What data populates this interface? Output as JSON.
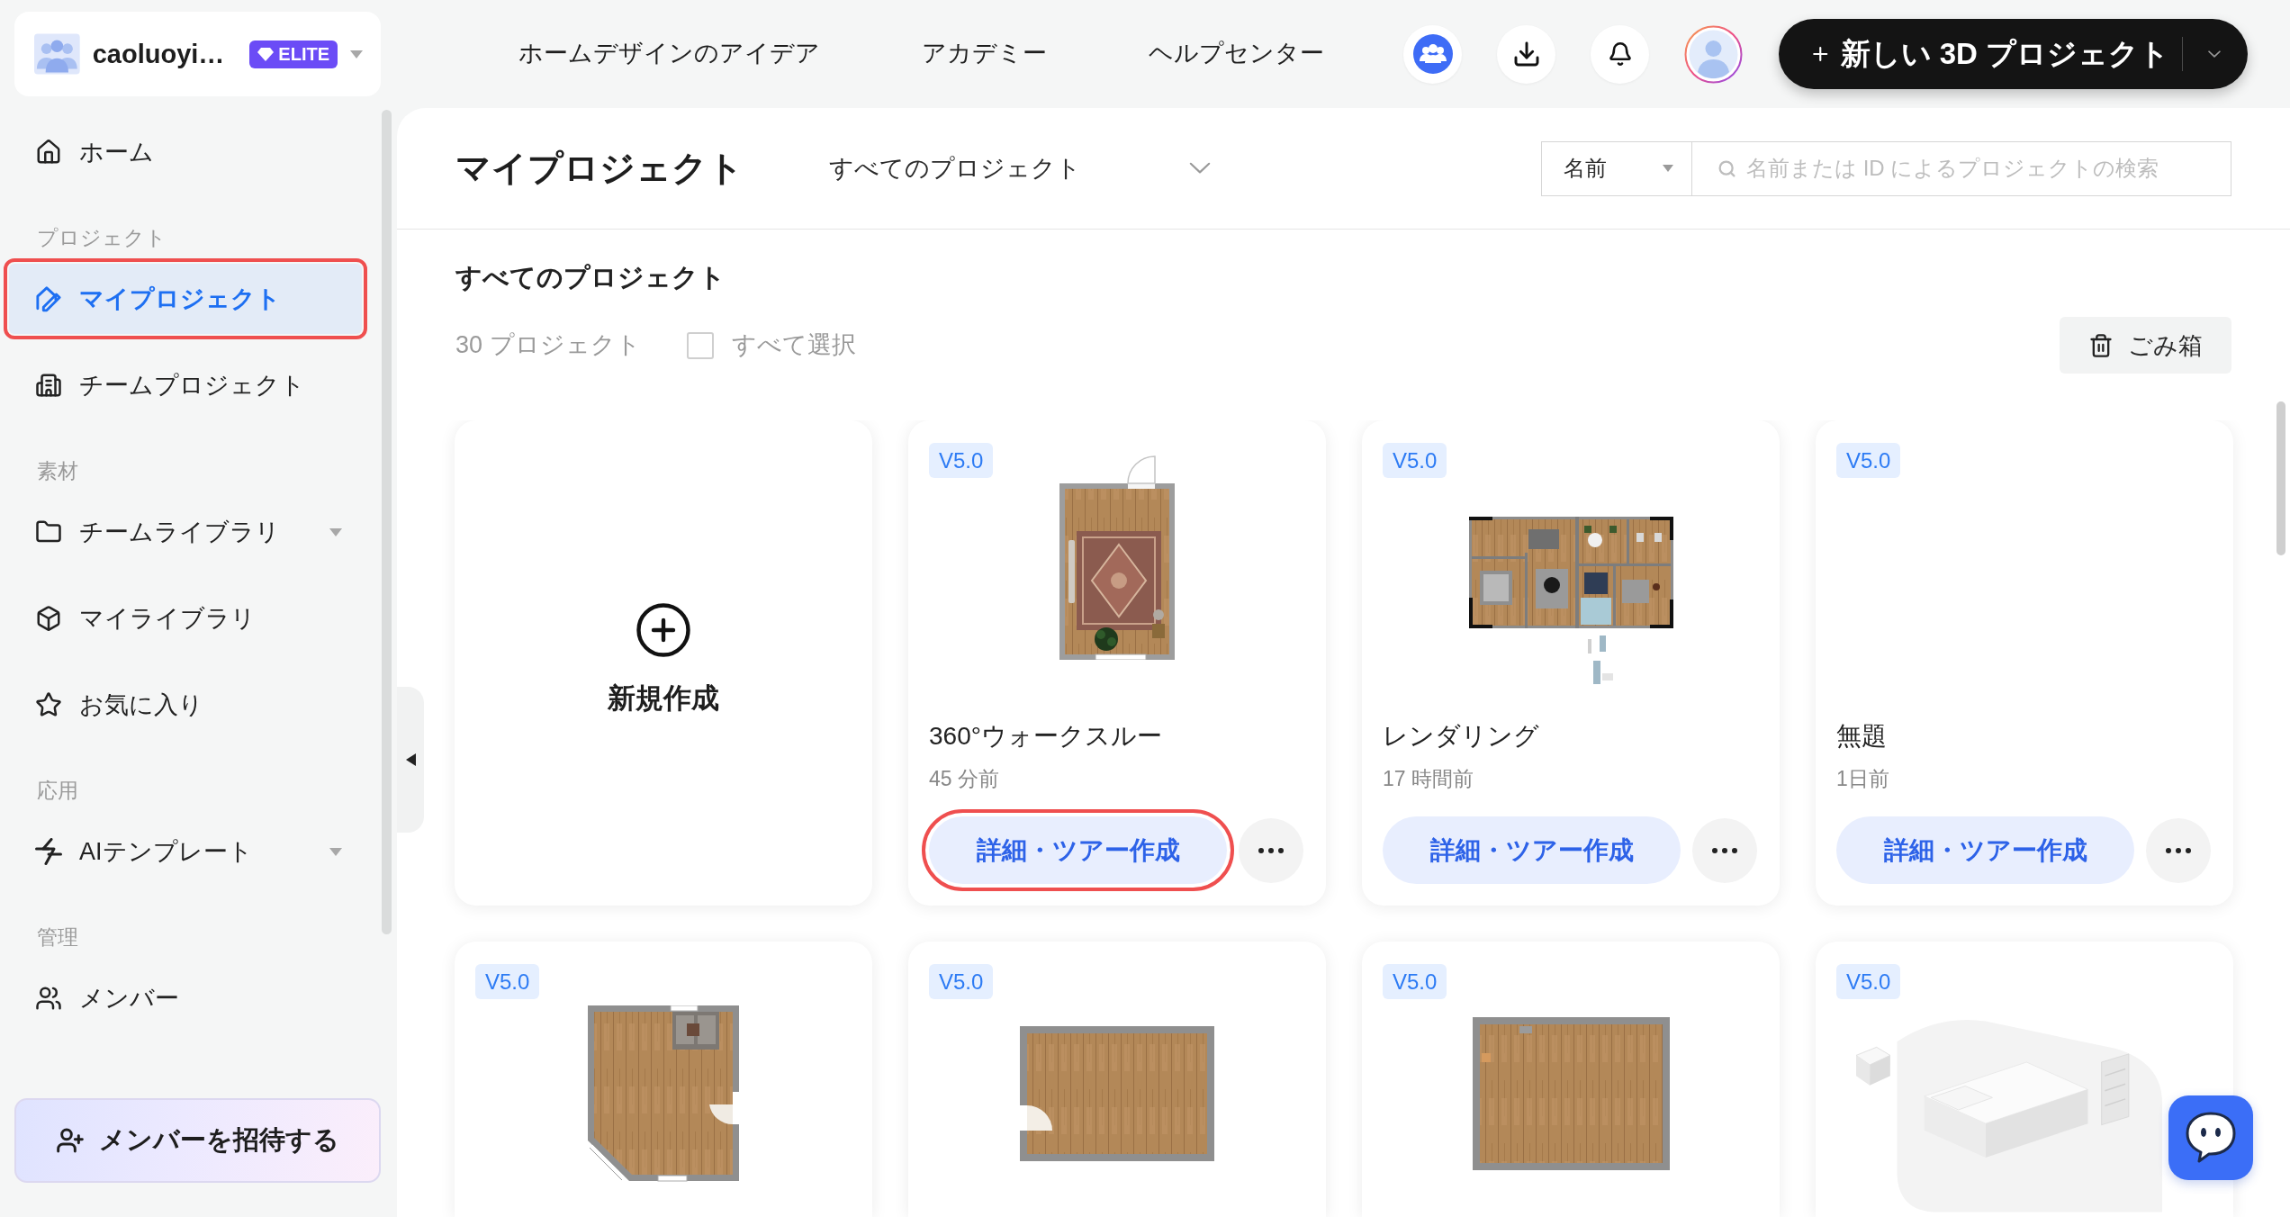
{
  "account": {
    "name": "caoluoyi…",
    "plan": "ELITE"
  },
  "sidebar": {
    "items": [
      {
        "kind": "item",
        "label": "ホーム",
        "selected": false,
        "highlighted": false,
        "expandable": false
      },
      {
        "kind": "section",
        "label": "プロジェクト"
      },
      {
        "kind": "item",
        "label": "マイプロジェクト",
        "selected": true,
        "highlighted": true,
        "expandable": false
      },
      {
        "kind": "item",
        "label": "チームプロジェクト",
        "selected": false,
        "highlighted": false,
        "expandable": false
      },
      {
        "kind": "section",
        "label": "素材"
      },
      {
        "kind": "item",
        "label": "チームライブラリ",
        "selected": false,
        "highlighted": false,
        "expandable": true
      },
      {
        "kind": "item",
        "label": "マイライブラリ",
        "selected": false,
        "highlighted": false,
        "expandable": false
      },
      {
        "kind": "item",
        "label": "お気に入り",
        "selected": false,
        "highlighted": false,
        "expandable": false
      },
      {
        "kind": "section",
        "label": "応用"
      },
      {
        "kind": "item",
        "label": "AIテンプレート",
        "selected": false,
        "highlighted": false,
        "expandable": true
      },
      {
        "kind": "section",
        "label": "管理"
      },
      {
        "kind": "item",
        "label": "メンバー",
        "selected": false,
        "highlighted": false,
        "expandable": false
      }
    ],
    "invite_button": "メンバーを招待する"
  },
  "topbar": {
    "nav": [
      "ホームデザインのアイデア",
      "アカデミー",
      "ヘルプセンター"
    ],
    "new_project_button": "新しい 3D プロジェクト"
  },
  "header": {
    "title": "マイプロジェクト",
    "filter": "すべてのプロジェクト",
    "sort": "名前",
    "search": {
      "placeholder": "名前または ID によるプロジェクトの検索"
    }
  },
  "section": {
    "title": "すべてのプロジェクト",
    "count": "30 プロジェクト",
    "select_all": {
      "label": "すべて選択",
      "checked": false
    },
    "trash_button": "ごみ箱"
  },
  "cards": [
    {
      "kind": "new",
      "label": "新規作成"
    },
    {
      "kind": "project",
      "version": "V5.0",
      "thumbnail": {
        "kind": "room"
      },
      "title": "360°ウォークスルー",
      "time": "45 分前",
      "button": "詳細・ツアー作成",
      "highlighted": true
    },
    {
      "kind": "project",
      "version": "V5.0",
      "thumbnail": {
        "kind": "apartment"
      },
      "title": "レンダリング",
      "time": "17 時間前",
      "button": "詳細・ツアー作成",
      "highlighted": false
    },
    {
      "kind": "project",
      "version": "V5.0",
      "title": "無題",
      "time": "1日前",
      "button": "詳細・ツアー作成",
      "highlighted": false
    },
    {
      "kind": "project",
      "version": "V5.0",
      "thumbnail": {
        "kind": "corner_room"
      }
    },
    {
      "kind": "project",
      "version": "V5.0",
      "thumbnail": {
        "kind": "door_room"
      }
    },
    {
      "kind": "project",
      "version": "V5.0",
      "thumbnail": {
        "kind": "plain_room"
      }
    },
    {
      "kind": "project",
      "version": "V5.0",
      "thumbnail": {
        "kind": "empty_room"
      }
    }
  ]
}
